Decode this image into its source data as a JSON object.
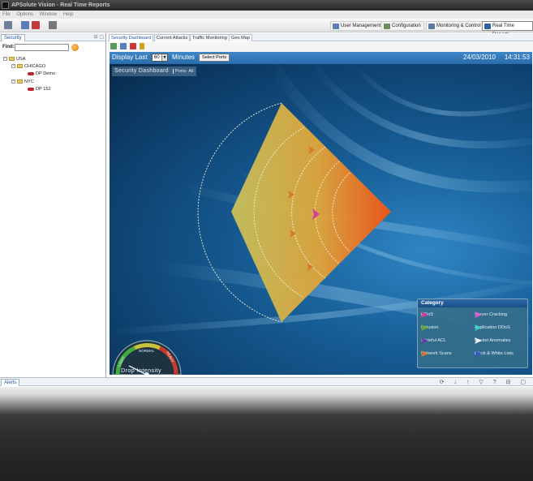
{
  "window": {
    "title": "APSolute Vision - Real Time Reports"
  },
  "menu": [
    "File",
    "Options",
    "Window",
    "Help"
  ],
  "nav": [
    {
      "label": "User Management",
      "icon": "users-icon",
      "color": "#5b7fb0"
    },
    {
      "label": "Configuration",
      "icon": "config-icon",
      "color": "#6b8f5a"
    },
    {
      "label": "Monitoring & Control",
      "icon": "monitor-icon",
      "color": "#5a7aa0"
    },
    {
      "label": "Real Time Reports",
      "icon": "report-icon",
      "color": "#2f62a8"
    }
  ],
  "left_panel": {
    "tab": "Security",
    "find_label": "Find:",
    "find_value": "",
    "tree": [
      {
        "label": "USA",
        "level": 0,
        "type": "folder"
      },
      {
        "label": "CHICAGO",
        "level": 1,
        "type": "folder"
      },
      {
        "label": "DP Demo",
        "level": 2,
        "type": "device"
      },
      {
        "label": "NYC",
        "level": 1,
        "type": "folder"
      },
      {
        "label": "DP 152",
        "level": 2,
        "type": "device"
      }
    ]
  },
  "tabs": [
    "Security Dashboard",
    "Current Attacks",
    "Traffic Monitoring",
    "Geo Map"
  ],
  "dashboard": {
    "display_last_label": "Display Last",
    "minutes_value": "60",
    "minutes_label": "Minutes",
    "select_ports": "Select Ports",
    "date": "24/03/2010",
    "time": "14:31:53",
    "title": "Security Dashboard",
    "ports_label": "Ports:",
    "ports_value": "All"
  },
  "gauge": {
    "title": "Drop Intensity",
    "labels": [
      "LIGHT",
      "NORMAL",
      "HEAVY"
    ]
  },
  "legend": {
    "title": "Category",
    "items": [
      {
        "label": "DDoS",
        "color": "#d43a9c"
      },
      {
        "label": "Server Cracking",
        "color": "#e05ad6"
      },
      {
        "label": "Intrusion",
        "color": "#6aa83a"
      },
      {
        "label": "Application DDoS",
        "color": "#39d3c8"
      },
      {
        "label": "Stateful ACL",
        "color": "#6a3aa8"
      },
      {
        "label": "Packet Anomalies",
        "color": "#f2f2f2"
      },
      {
        "label": "Network Scans",
        "color": "#d8782a"
      },
      {
        "label": "Black & White Lists",
        "color": "#3a55c8"
      }
    ]
  },
  "alerts": {
    "tab": "Alerts"
  },
  "colors": {
    "radar_inner": "#e8541c",
    "radar_outer": "#c9c15a",
    "arrow_network_scans": "#d8782a",
    "arrow_ddos": "#d43a9c"
  }
}
